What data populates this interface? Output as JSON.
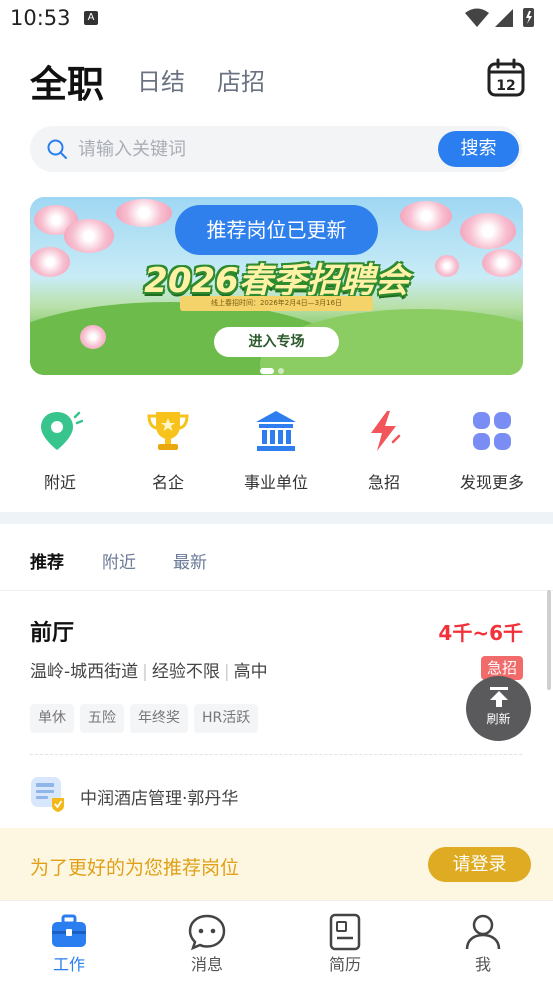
{
  "status": {
    "time": "10:53",
    "a_icon": "A"
  },
  "topnav": {
    "tabs": [
      "全职",
      "日结",
      "店招"
    ],
    "calendar_day": "12"
  },
  "search": {
    "placeholder": "请输入关键词",
    "button": "搜索"
  },
  "banner": {
    "pill": "推荐岗位已更新",
    "title": "2026春季招聘会",
    "dates": "线上春招时间：2026年2月4日—3月16日",
    "enter": "进入专场"
  },
  "quick": [
    {
      "label": "附近",
      "icon": "location-pin-icon"
    },
    {
      "label": "名企",
      "icon": "trophy-icon"
    },
    {
      "label": "事业单位",
      "icon": "government-building-icon"
    },
    {
      "label": "急招",
      "icon": "lightning-icon"
    },
    {
      "label": "发现更多",
      "icon": "grid-more-icon"
    }
  ],
  "feed_tabs": [
    "推荐",
    "附近",
    "最新"
  ],
  "job": {
    "title": "前厅",
    "salary": "4千~6千",
    "location": "温岭-城西街道",
    "experience": "经验不限",
    "education": "高中",
    "urgent": "急招",
    "tags": [
      "单休",
      "五险",
      "年终奖",
      "HR活跃"
    ],
    "company": "中润酒店管理·郭丹华"
  },
  "refresh": {
    "label": "刷新"
  },
  "login_bar": {
    "text": "为了更好的为您推荐岗位",
    "button": "请登录"
  },
  "bottom_nav": [
    {
      "label": "工作",
      "icon": "briefcase-icon"
    },
    {
      "label": "消息",
      "icon": "chat-icon"
    },
    {
      "label": "简历",
      "icon": "resume-icon"
    },
    {
      "label": "我",
      "icon": "user-icon"
    }
  ],
  "colors": {
    "accent": "#2b7ef0",
    "salary": "#f2323a",
    "urgent": "#f26b6b",
    "login": "#deab22"
  }
}
